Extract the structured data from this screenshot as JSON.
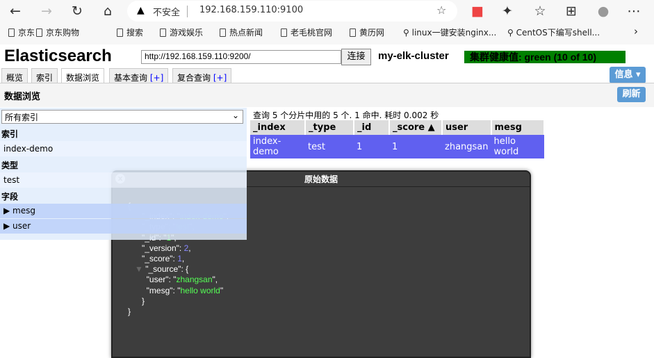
{
  "browser": {
    "insecure": "不安全",
    "url": "192.168.159.110:9100",
    "bookmarks": [
      "京东",
      "京东购物",
      "搜索",
      "游戏娱乐",
      "热点新闻",
      "老毛桃官网",
      "黄历网",
      "linux一键安装nginx...",
      "CentOS下编写shell..."
    ]
  },
  "app": {
    "title": "Elasticsearch",
    "cluster_url": "http://192.168.159.110:9200/",
    "connect": "连接",
    "cluster_name": "my-elk-cluster",
    "health": "集群健康值: green (10 of 10)",
    "tabs": [
      "概览",
      "索引",
      "数据浏览",
      "基本查询",
      "复合查询"
    ],
    "tab_plus": "[+]",
    "info": "信息 ▾"
  },
  "browse": {
    "title": "数据浏览",
    "refresh": "刷新",
    "index_select": "所有索引",
    "sections": {
      "index": "索引",
      "type": "类型",
      "field": "字段"
    },
    "index_item": "index-demo",
    "type_item": "test",
    "fields": [
      "mesg",
      "user"
    ],
    "summary": "查询 5 个分片中用的 5 个. 1 命中. 耗时 0.002 秒",
    "columns": [
      "_index",
      "_type",
      "_id",
      "_score ▲",
      "user",
      "mesg"
    ],
    "rows": [
      [
        "index-demo",
        "test",
        "1",
        "1",
        "zhangsan",
        "hello world"
      ]
    ]
  },
  "dialog": {
    "title": "原始数据",
    "close": "x",
    "json": {
      "_index": "index-demo",
      "_type": "test",
      "_id": "1",
      "_version": "2",
      "_score": "1",
      "user": "zhangsan",
      "mesg": "hello world"
    }
  }
}
